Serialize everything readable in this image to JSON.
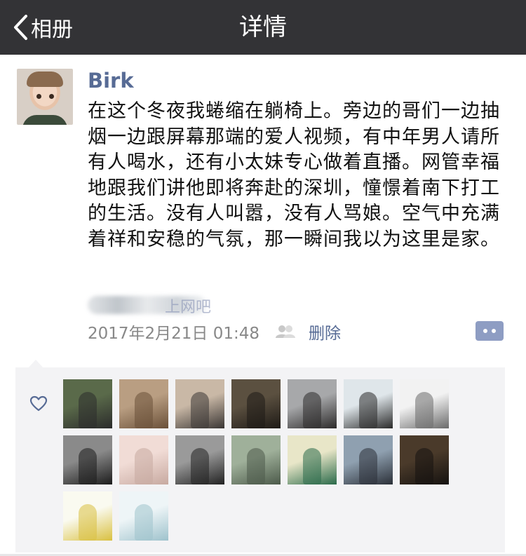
{
  "nav": {
    "back_label": "相册",
    "title": "详情"
  },
  "post": {
    "username": "Birk",
    "text": "在这个冬夜我蜷缩在躺椅上。旁边的哥们一边抽烟一边跟屏幕那端的爱人视频，有中年男人请所有人喝水，还有小太妹专心做着直播。网管幸福地跟我们讲他即将奔赴的深圳，憧憬着南下打工的生活。没有人叫嚣，没有人骂娘。空气中充满着祥和安稳的气氛，那一瞬间我以为这里是家。",
    "location_visible": "上网吧",
    "timestamp": "2017年2月21日 01:48",
    "delete_label": "删除"
  },
  "likes": {
    "avatars": [
      {
        "name": "avatar-rider",
        "colors": [
          "#5a6a4a",
          "#2b2b2b"
        ]
      },
      {
        "name": "avatar-child",
        "colors": [
          "#b99e82",
          "#6a5038"
        ]
      },
      {
        "name": "avatar-seaside",
        "colors": [
          "#c9b8a6",
          "#3a3634"
        ]
      },
      {
        "name": "avatar-dark-scene",
        "colors": [
          "#5b5040",
          "#1e1a16"
        ]
      },
      {
        "name": "avatar-man-jacket",
        "colors": [
          "#a7a8aa",
          "#2c2a2a"
        ]
      },
      {
        "name": "avatar-glasses-boy",
        "colors": [
          "#dfe6ea",
          "#2a2a2a"
        ]
      },
      {
        "name": "avatar-anime",
        "colors": [
          "#f2f2f2",
          "#6b6b6b"
        ]
      },
      {
        "name": "avatar-dog",
        "colors": [
          "#8a8a8a",
          "#1c1c1c"
        ]
      },
      {
        "name": "avatar-woman-pink",
        "colors": [
          "#f1dcd6",
          "#c7a9a0"
        ]
      },
      {
        "name": "avatar-bw-portrait",
        "colors": [
          "#9a9a9a",
          "#222222"
        ]
      },
      {
        "name": "avatar-sketch",
        "colors": [
          "#9fb09a",
          "#4c5a4a"
        ]
      },
      {
        "name": "avatar-text-poster",
        "colors": [
          "#e8e6c8",
          "#2a6a4a"
        ]
      },
      {
        "name": "avatar-train",
        "colors": [
          "#8fa0b0",
          "#2b3038"
        ]
      },
      {
        "name": "avatar-gorilla",
        "colors": [
          "#4a3a2a",
          "#151210"
        ]
      },
      {
        "name": "avatar-bees",
        "colors": [
          "#fafaf0",
          "#d9c040"
        ]
      },
      {
        "name": "avatar-feather",
        "colors": [
          "#eef5f7",
          "#9ec2cc"
        ]
      }
    ]
  },
  "colors": {
    "navbar_bg": "#333336",
    "link": "#576b95",
    "likes_bg": "#f3f3f5"
  }
}
